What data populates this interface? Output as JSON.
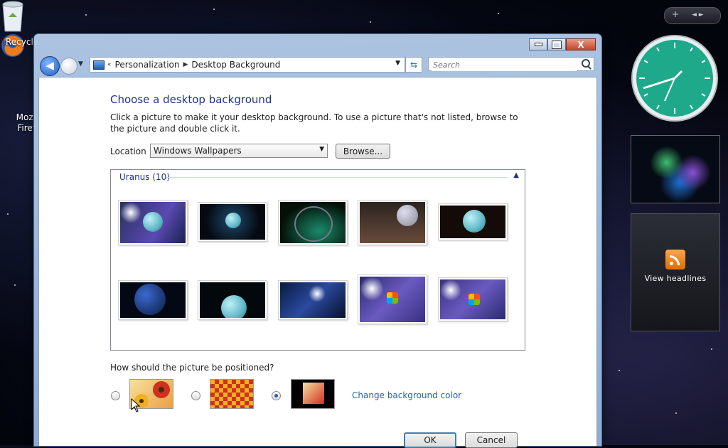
{
  "desktop": {
    "recycle_label": "Recycle",
    "firefox_label_1": "Mozi",
    "firefox_label_2": "Firef"
  },
  "sidebar": {
    "add_glyph": "+",
    "nav_glyph": "◄ ►",
    "feed_label": "View headlines"
  },
  "window": {
    "breadcrumb": [
      "Personalization",
      "Desktop Background"
    ],
    "breadcrumb_prefix": "«",
    "search_placeholder": "Search",
    "close_glyph": "X"
  },
  "content": {
    "title": "Choose a desktop background",
    "description": "Click a picture to make it your desktop background. To use a picture that's not listed, browse to the picture and double click it.",
    "location_label": "Location",
    "location_value": "Windows Wallpapers",
    "browse_label": "Browse...",
    "group_name": "Uranus (10)",
    "position_question": "How should the picture be positioned?",
    "change_color_link": "Change background color",
    "selected_position": "center",
    "ok_label": "OK",
    "cancel_label": "Cancel"
  },
  "wallpapers": [
    {
      "name": "uranus-1",
      "bg": "#3c4fa8"
    },
    {
      "name": "uranus-2",
      "bg": "#0b1a2a"
    },
    {
      "name": "uranus-3",
      "bg": "#07140f"
    },
    {
      "name": "uranus-4",
      "bg": "#1a1410"
    },
    {
      "name": "uranus-5",
      "bg": "#140a08"
    },
    {
      "name": "uranus-6",
      "bg": "#030814"
    },
    {
      "name": "uranus-7",
      "bg": "#03080c"
    },
    {
      "name": "uranus-8",
      "bg": "#0a1a40"
    },
    {
      "name": "uranus-9",
      "bg": "#4a40a0"
    },
    {
      "name": "uranus-10",
      "bg": "#5a48b0"
    }
  ],
  "colors": {
    "title": "#1e3287",
    "link": "#1f5fbf",
    "clock_face": "#20b090"
  }
}
